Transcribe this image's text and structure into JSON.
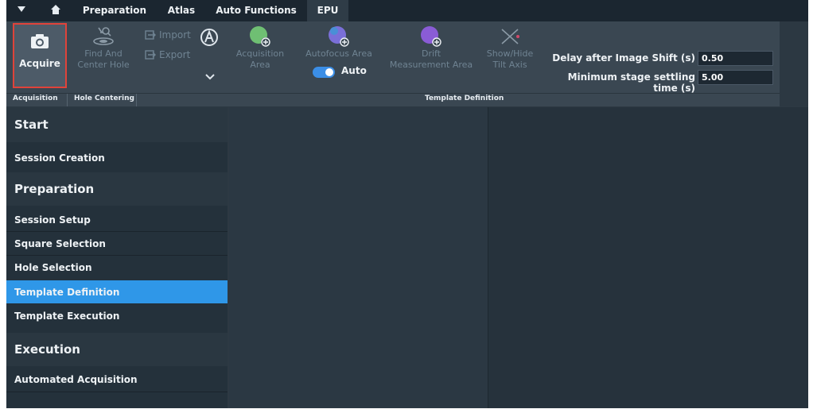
{
  "menubar": {
    "tabs": [
      {
        "label": "Preparation",
        "active": false
      },
      {
        "label": "Atlas",
        "active": false
      },
      {
        "label": "Auto Functions",
        "active": false
      },
      {
        "label": "EPU",
        "active": true
      }
    ]
  },
  "ribbon": {
    "acquire_label": "Acquire",
    "find_center_label": "Find And\nCenter Hole",
    "import_label": "Import",
    "export_label": "Export",
    "acquisition_area_label": "Acquisition\nArea",
    "autofocus_area_label": "Autofocus Area",
    "auto_toggle_label": "Auto",
    "drift_label": "Drift\nMeasurement Area",
    "show_hide_label": "Show/Hide\nTilt Axis",
    "delay_label": "Delay after Image Shift (s)",
    "delay_value": "0.50",
    "settling_label": "Minimum stage settling time (s)",
    "settling_value": "5.00"
  },
  "groups": {
    "acquisition": "Acquisition",
    "hole_centering": "Hole Centering",
    "template_definition": "Template Definition"
  },
  "nav": {
    "start_header": "Start",
    "session_creation": "Session Creation",
    "preparation_header": "Preparation",
    "session_setup": "Session Setup",
    "square_selection": "Square Selection",
    "hole_selection": "Hole Selection",
    "template_definition": "Template Definition",
    "template_execution": "Template Execution",
    "execution_header": "Execution",
    "automated_acquisition": "Automated Acquisition",
    "selected": "Template Definition"
  },
  "colors": {
    "accent": "#2f97e8",
    "highlight_border": "#e0433a",
    "green_icon": "#6fbf73",
    "purple_icon": "#8a5cd6"
  },
  "icons": [
    "camera-icon",
    "find-center-icon",
    "import-icon",
    "export-icon",
    "auto-function-icon",
    "chevron-down-icon",
    "acquisition-area-icon",
    "autofocus-area-icon",
    "drift-area-icon",
    "tilt-axis-icon",
    "home-icon",
    "menu-caret-icon"
  ]
}
